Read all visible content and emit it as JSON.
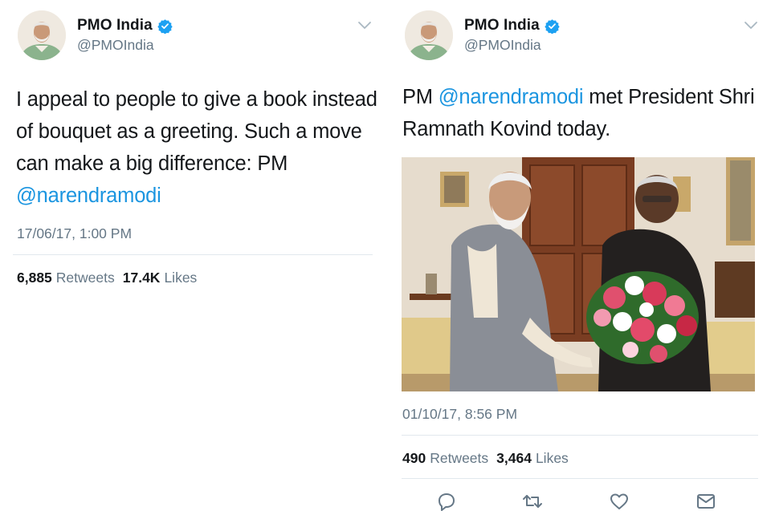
{
  "tweets": [
    {
      "author": {
        "name": "PMO India",
        "handle": "@PMOIndia"
      },
      "text_plain": "I appeal to people to give a book instead of bouquet as a greeting. Such a move can make a big difference: PM ",
      "text_mention": "@narendramodi",
      "timestamp": "17/06/17, 1:00 PM",
      "stats": {
        "retweets_count": "6,885",
        "retweets_label": "Retweets",
        "likes_count": "17.4K",
        "likes_label": "Likes"
      }
    },
    {
      "author": {
        "name": "PMO India",
        "handle": "@PMOIndia"
      },
      "text_prefix": "PM ",
      "text_mention": "@narendramodi",
      "text_suffix": " met President Shri Ramnath Kovind today.",
      "timestamp": "01/10/17, 8:56 PM",
      "stats": {
        "retweets_count": "490",
        "retweets_label": "Retweets",
        "likes_count": "3,464",
        "likes_label": "Likes"
      },
      "actions": [
        "reply-icon",
        "retweet-icon",
        "like-icon",
        "direct-message-icon"
      ]
    }
  ],
  "colors": {
    "link": "#1b95e0",
    "secondary_text": "#657786",
    "primary_text": "#14171a",
    "verified": "#1da1f2",
    "divider": "#e1e8ed"
  }
}
